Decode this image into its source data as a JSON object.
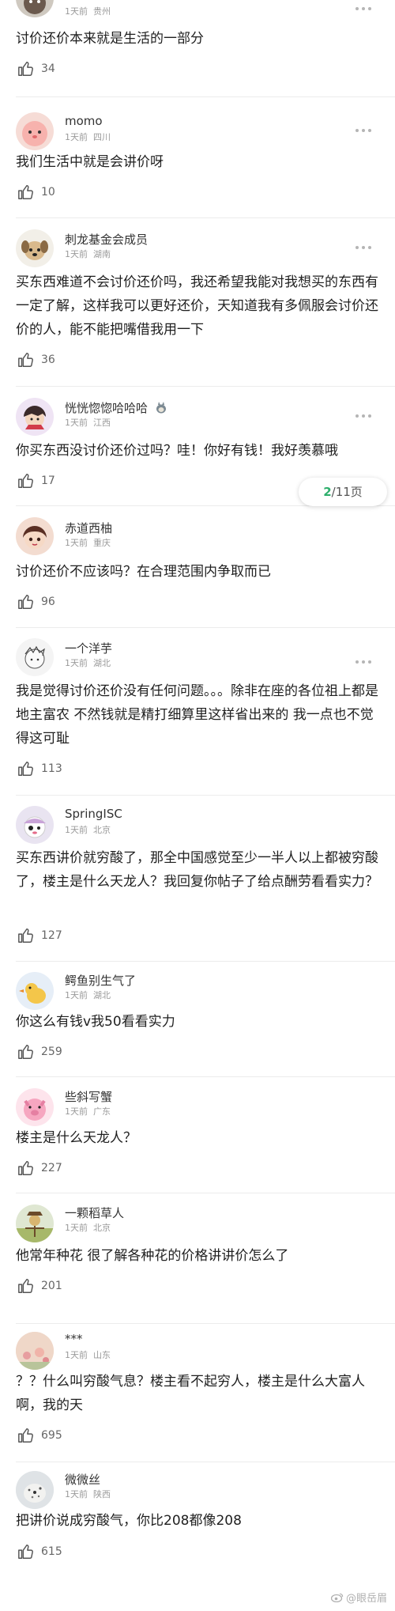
{
  "comments": [
    {
      "username": "",
      "time": "1天前",
      "location": "贵州",
      "content": "讨价还价本来就是生活的一部分",
      "likes": "34",
      "avatar": "cat-avatar"
    },
    {
      "username": "momo",
      "time": "1天前",
      "location": "四川",
      "content": "我们生活中就是会讲价呀",
      "likes": "10",
      "avatar": "pink-blob-avatar"
    },
    {
      "username": "刺龙基金会成员",
      "time": "1天前",
      "location": "湖南",
      "content": "买东西难道不会讨价还价吗，我还希望我能对我想买的东西有一定了解，这样我可以更好还价，天知道我有多佩服会讨价还价的人，能不能把嘴借我用一下",
      "likes": "36",
      "avatar": "dog-avatar"
    },
    {
      "username": "恍恍惚惚哈哈哈",
      "time": "1天前",
      "location": "江西",
      "content": "你买东西没讨价还价过吗？哇！你好有钱！我好羡慕哦",
      "likes": "17",
      "avatar": "girl-avatar",
      "badge": "totoro-icon"
    },
    {
      "username": "赤道西柚",
      "time": "1天前",
      "location": "重庆",
      "content": "讨价还价不应该吗？在合理范围内争取而已",
      "likes": "96",
      "avatar": "anime-avatar"
    },
    {
      "username": "一个洋芋",
      "time": "1天前",
      "location": "湖北",
      "content": "我是觉得讨价还价没有任何问题。。。除非在座的各位祖上都是地主富农 不然钱就是精打细算里这样省出来的 我一点也不觉得这可耻",
      "likes": "113",
      "avatar": "sketch-avatar"
    },
    {
      "username": "SpringISC",
      "time": "1天前",
      "location": "北京",
      "content": "买东西讲价就穷酸了，那全中国感觉至少一半人以上都被穷酸了，楼主是什么天龙人？我回复你帖子了给点酬劳看看实力？",
      "likes": "127",
      "avatar": "pirate-avatar"
    },
    {
      "username": "鳄鱼别生气了",
      "time": "1天前",
      "location": "湖北",
      "content": "你这么有钱v我50看看实力",
      "likes": "259",
      "avatar": "duck-avatar"
    },
    {
      "username": "些斜写蟹",
      "time": "1天前",
      "location": "广东",
      "content": "楼主是什么天龙人？",
      "likes": "227",
      "avatar": "pig-avatar"
    },
    {
      "username": "一颗稻草人",
      "time": "1天前",
      "location": "北京",
      "content": "他常年种花 很了解各种花的价格讲讲价怎么了",
      "likes": "201",
      "avatar": "scarecrow-avatar"
    },
    {
      "username": "***",
      "time": "1天前",
      "location": "山东",
      "content": "？？什么叫穷酸气息？楼主看不起穷人，楼主是什么大富人啊，我的天",
      "likes": "695",
      "avatar": "flower-avatar"
    },
    {
      "username": "微微丝",
      "time": "1天前",
      "location": "陕西",
      "content": "把讲价说成穷酸气，你比208都像208",
      "likes": "615",
      "avatar": "leopard-avatar"
    }
  ],
  "page_indicator": {
    "current": "2",
    "rest": "/11页"
  },
  "watermark": "@眼岳眉",
  "colors": {
    "accent": "#2eaf6c",
    "meta": "#9a9a9a",
    "divider": "#ececec"
  }
}
